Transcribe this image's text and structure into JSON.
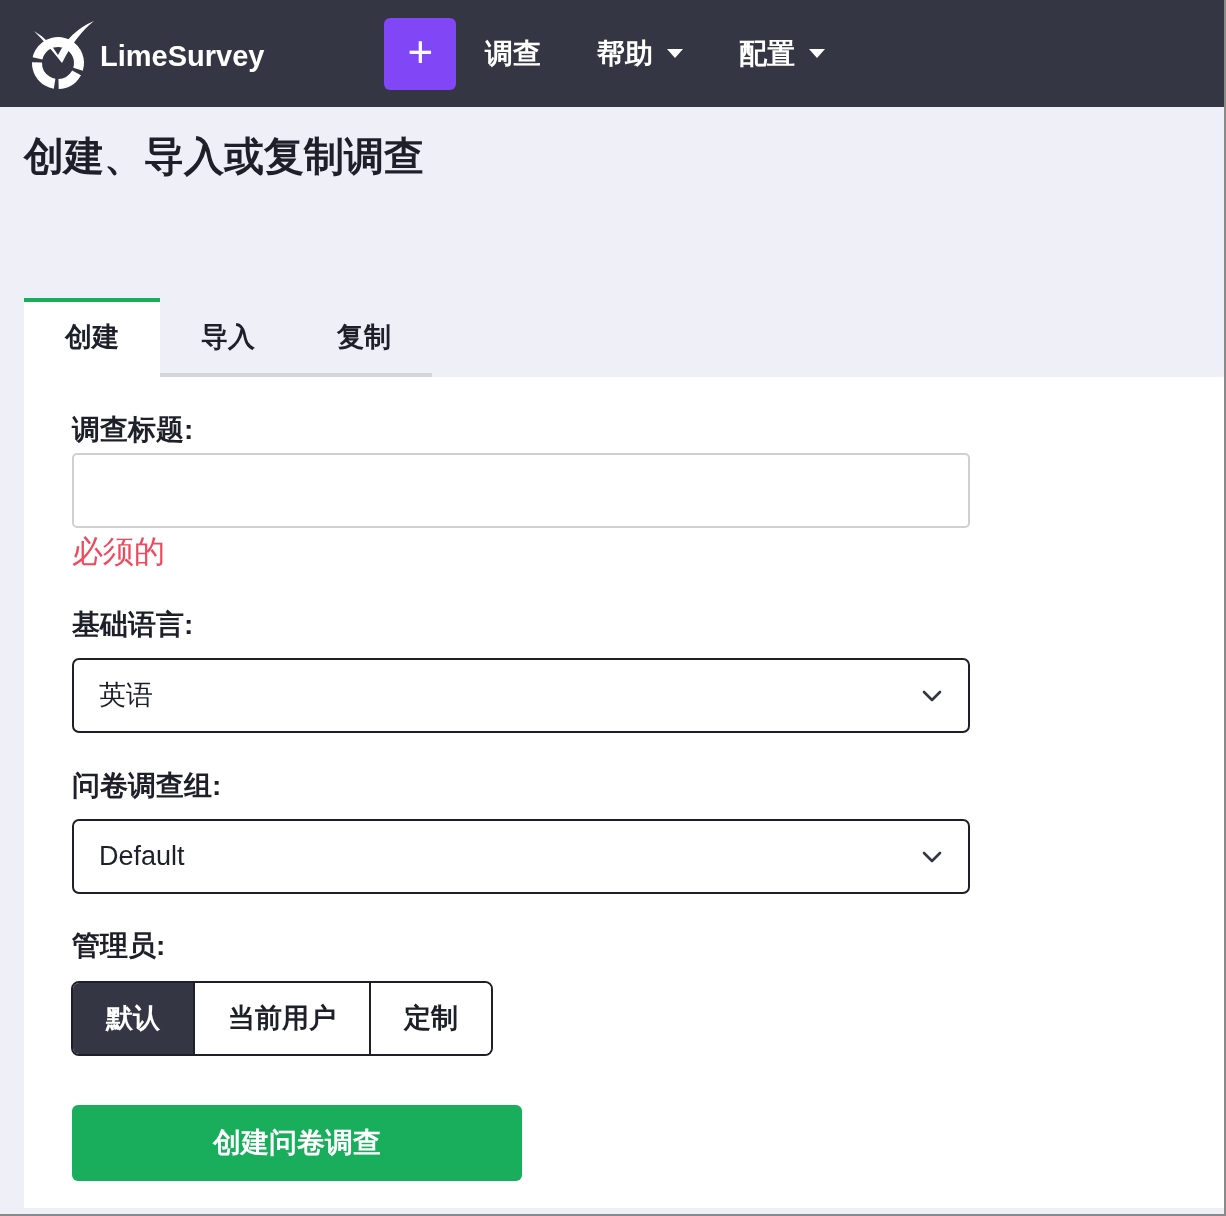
{
  "navbar": {
    "brand": "LimeSurvey",
    "add_button": "+",
    "menu": [
      {
        "label": "调查",
        "dropdown": false
      },
      {
        "label": "帮助",
        "dropdown": true
      },
      {
        "label": "配置",
        "dropdown": true
      }
    ]
  },
  "page_title": "创建、导入或复制调查",
  "tabs": [
    {
      "label": "创建",
      "selected": true
    },
    {
      "label": "导入",
      "selected": false
    },
    {
      "label": "复制",
      "selected": false
    }
  ],
  "form": {
    "fields": [
      {
        "kind": "text",
        "label": "调查标题:",
        "error": "必须的"
      },
      {
        "kind": "select",
        "label": "基础语言:",
        "value": "英语"
      },
      {
        "kind": "select",
        "label": "问卷调查组:",
        "value": "Default"
      },
      {
        "kind": "segmented",
        "label": "管理员:",
        "options": [
          {
            "label": "默认",
            "selected": true
          },
          {
            "label": "当前用户",
            "selected": false
          },
          {
            "label": "定制",
            "selected": false
          }
        ]
      }
    ],
    "submit": "创建问卷调查"
  }
}
